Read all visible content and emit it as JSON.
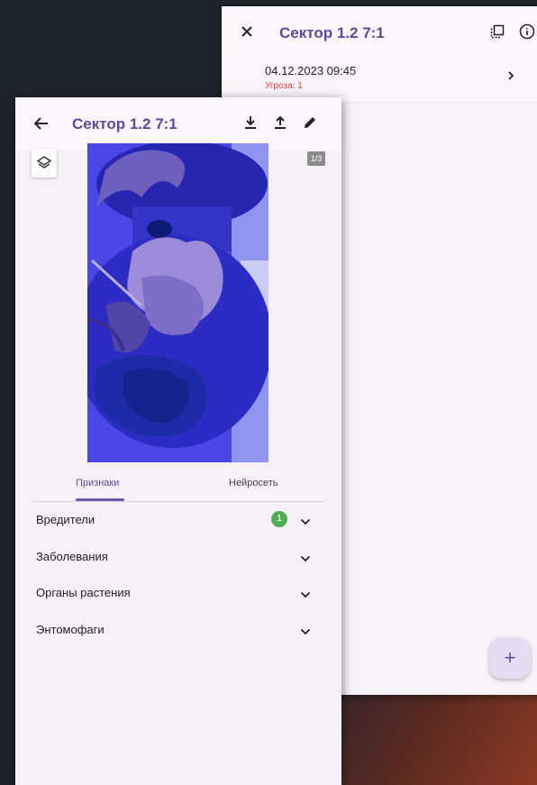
{
  "back_window": {
    "title": "Сектор 1.2 7:1",
    "entries": [
      {
        "datetime": "04.12.2023 09:45",
        "threat": "Угроза: 1"
      }
    ],
    "fab_symbol": "+",
    "icons": [
      "close-icon",
      "copy-icon",
      "info-icon",
      "chevron-right-icon",
      "add-icon"
    ]
  },
  "front_window": {
    "title": "Сектор 1.2 7:1",
    "image_counter": "1/3",
    "tabs": [
      {
        "label": "Признаки",
        "active": true
      },
      {
        "label": "Нейросеть",
        "active": false
      }
    ],
    "categories": [
      {
        "label": "Вредители",
        "badge": "1"
      },
      {
        "label": "Заболевания"
      },
      {
        "label": "Органы растения"
      },
      {
        "label": "Энтомофаги"
      }
    ],
    "icons": [
      "back-arrow-icon",
      "download-icon",
      "upload-icon",
      "edit-icon",
      "layers-icon",
      "chevron-down-icon"
    ]
  },
  "colors": {
    "accent": "#5b4a9e",
    "threat": "#e53935",
    "badge": "#4caf50",
    "surface": "#f8f0f8"
  }
}
